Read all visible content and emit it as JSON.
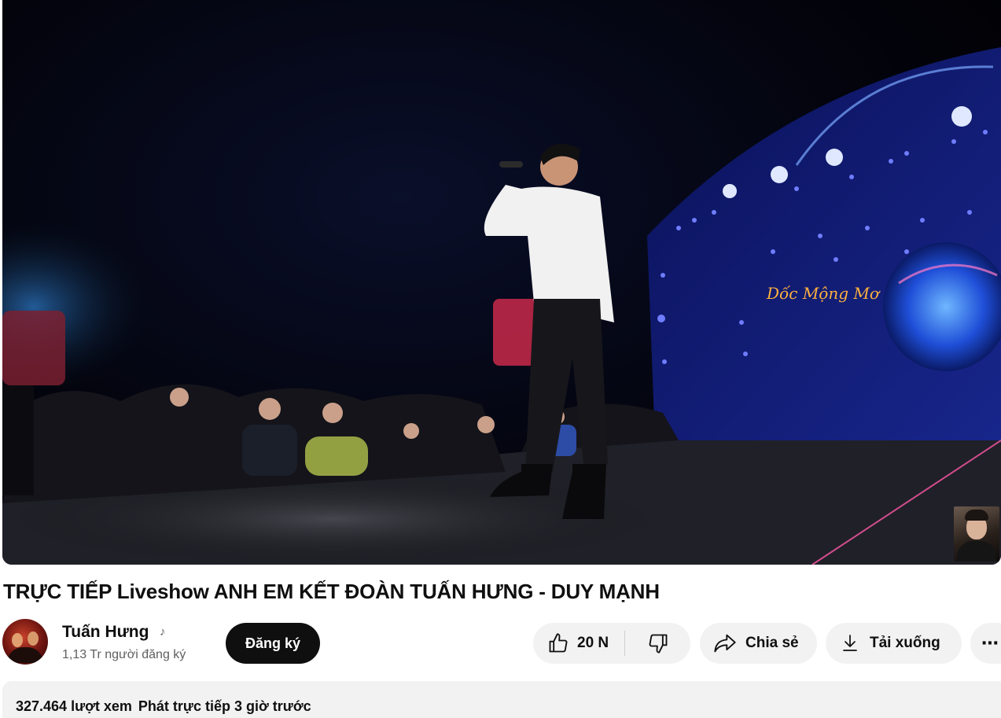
{
  "video": {
    "title": "TRỰC TIẾP Liveshow ANH EM KẾT ĐOÀN TUẤN HƯNG - DUY MẠNH",
    "stage_sign": "Dốc Mộng Mơ"
  },
  "channel": {
    "name": "Tuấn Hưng",
    "subscribers": "1,13 Tr người đăng ký",
    "subscribe_label": "Đăng ký"
  },
  "actions": {
    "like_count": "20 N",
    "share_label": "Chia sẻ",
    "download_label": "Tải xuống",
    "more_label": "⋯"
  },
  "description": {
    "views": "327.464 lượt xem",
    "streamed": "Phát trực tiếp 3 giờ trước"
  },
  "icons": {
    "like": "thumb-up-icon",
    "dislike": "thumb-down-icon",
    "share": "share-arrow-icon",
    "download": "download-icon",
    "music": "music-note-icon"
  }
}
